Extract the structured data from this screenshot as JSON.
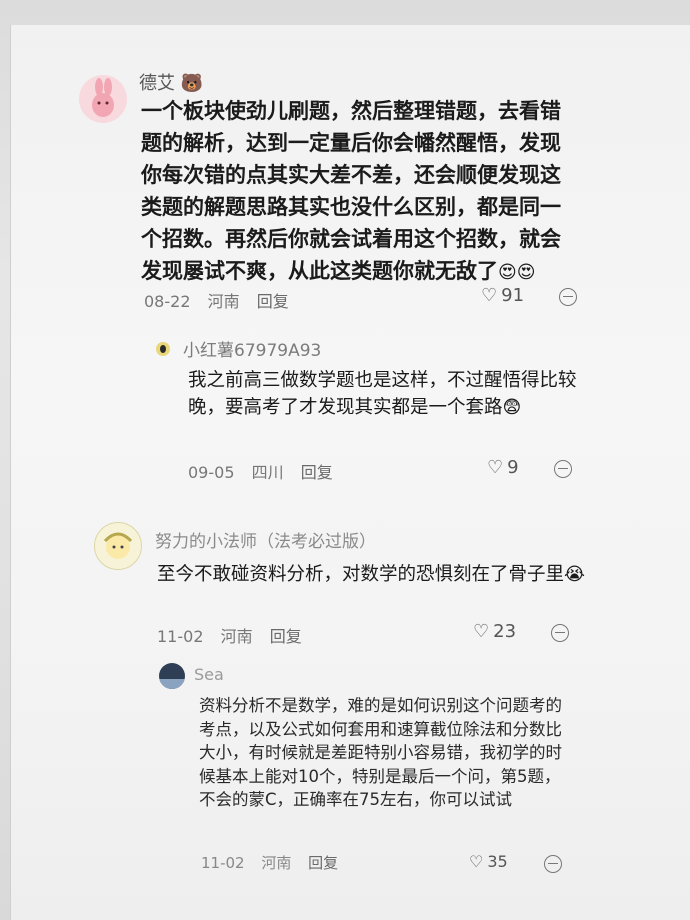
{
  "comments": [
    {
      "name": "德艾",
      "text": "一个板块使劲儿刷题，然后整理错题，去看错题的解析，达到一定量后你会幡然醒悟，发现你每次错的点其实大差不差，还会顺便发现这类题的解题思路其实也没什么区别，都是同一个招数。再然后你就会试着用这个招数，就会发现屡试不爽，从此这类题你就无敌了",
      "date": "08-22",
      "location": "河南",
      "reply": "回复",
      "likes": "91"
    },
    {
      "name": "小红薯67979A93",
      "text": "我之前高三做数学题也是这样，不过醒悟得比较晚，要高考了才发现其实都是一个套路",
      "date": "09-05",
      "location": "四川",
      "reply": "回复",
      "likes": "9"
    },
    {
      "name": "努力的小法师（法考必过版）",
      "text": "至今不敢碰资料分析，对数学的恐惧刻在了骨子里",
      "date": "11-02",
      "location": "河南",
      "reply": "回复",
      "likes": "23"
    },
    {
      "name": "Sea",
      "text": "资料分析不是数学，难的是如何识别这个问题考的考点，以及公式如何套用和速算截位除法和分数比大小，有时候就是差距特别小容易错，我初学的时候基本上能对10个，特别是最后一个问，第5题，不会的蒙C，正确率在75左右，你可以试试",
      "date": "11-02",
      "location": "河南",
      "reply": "回复",
      "likes": "35"
    }
  ],
  "icons": [
    "heart-icon",
    "more-icon",
    "badge-icon"
  ]
}
